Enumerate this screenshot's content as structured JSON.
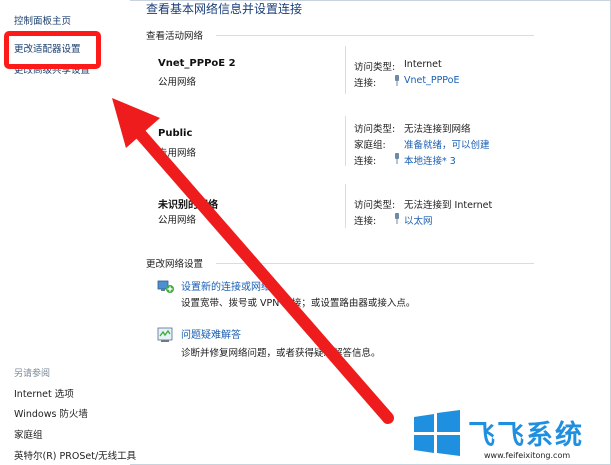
{
  "left_pane": {
    "home": "控制面板主页",
    "change_adapter": "更改适配器设置",
    "advanced_sharing": "更改高级共享设置",
    "see_also": "另请参阅",
    "bottom_links": [
      "Internet 选项",
      "Windows 防火墙",
      "家庭组",
      "英特尔(R) PROSet/无线工具"
    ]
  },
  "main": {
    "title": "查看基本网络信息并设置连接",
    "active_networks_header": "查看活动网络",
    "networks": [
      {
        "name": "Vnet_PPPoE  2",
        "type": "公用网络",
        "access_label": "访问类型:",
        "access_value": "Internet",
        "conn_label": "连接:",
        "conn_value": "Vnet_PPPoE"
      },
      {
        "name": "Public",
        "type": "专用网络",
        "access_label": "访问类型:",
        "access_value": "无法连接到网络",
        "homegroup_label": "家庭组:",
        "homegroup_value": "准备就绪，可以创建",
        "conn_label": "连接:",
        "conn_value": "本地连接* 3"
      },
      {
        "name": "未识别的网络",
        "type": "公用网络",
        "access_label": "访问类型:",
        "access_value": "无法连接到 Internet",
        "conn_label": "连接:",
        "conn_value": "以太网"
      }
    ],
    "change_settings_header": "更改网络设置",
    "tasks": [
      {
        "link": "设置新的连接或网络",
        "desc": "设置宽带、拨号或 VPN 连接；或设置路由器或接入点。"
      },
      {
        "link": "问题疑难解答",
        "desc": "诊断并修复网络问题，或者获得疑难解答信息。"
      }
    ]
  },
  "watermark": {
    "brand": "飞飞系统",
    "url": "www.feifeixitong.com"
  },
  "colors": {
    "link_blue": "#1a5fb4",
    "title_blue": "#1b3f78",
    "highlight_red": "#ff1a1a",
    "brand_blue": "#1f8fe0"
  }
}
